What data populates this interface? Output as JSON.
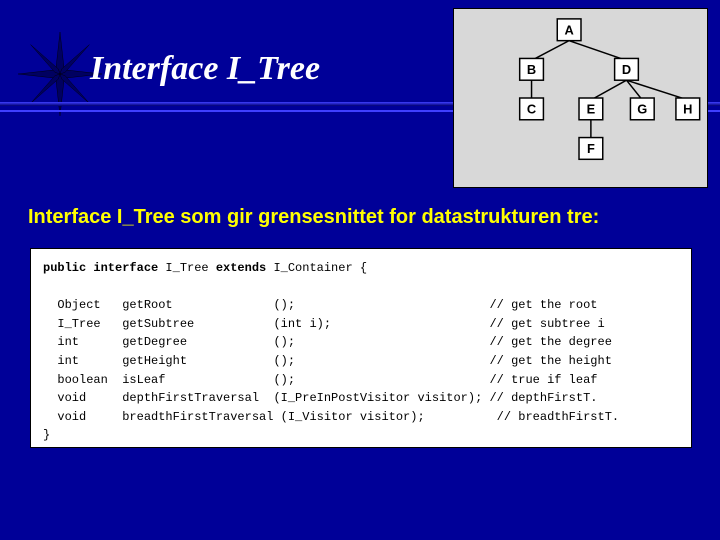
{
  "header": {
    "title": "Interface  I_Tree"
  },
  "tree": {
    "nodes": {
      "A": "A",
      "B": "B",
      "C": "C",
      "D": "D",
      "E": "E",
      "F": "F",
      "G": "G",
      "H": "H"
    }
  },
  "subtitle": "Interface I_Tree som gir grensesnittet for datastrukturen tre:",
  "code": {
    "l1a": "public interface",
    "l1b": " I_Tree ",
    "l1c": "extends",
    "l1d": " I_Container {",
    "l2": "",
    "l3": "  Object   getRoot              ();                           // get the root",
    "l4": "  I_Tree   getSubtree           (int i);                      // get subtree i",
    "l5": "  int      getDegree            ();                           // get the degree",
    "l6": "  int      getHeight            ();                           // get the height",
    "l7": "  boolean  isLeaf               ();                           // true if leaf",
    "l8": "  void     depthFirstTraversal  (I_PreInPostVisitor visitor); // depthFirstT.",
    "l9": "  void     breadthFirstTraversal (I_Visitor visitor);          // breadthFirstT.",
    "l10": "}"
  }
}
